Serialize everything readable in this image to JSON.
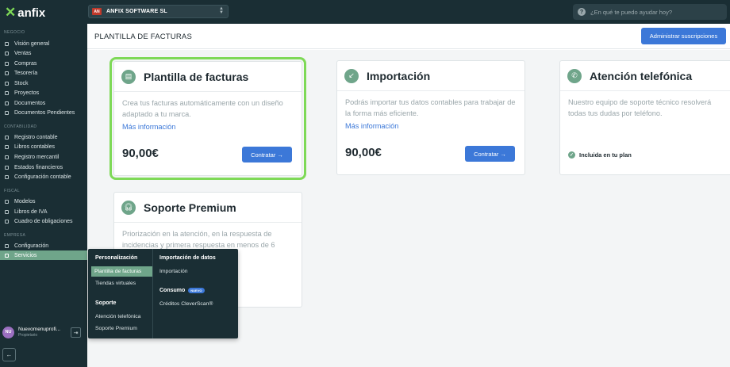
{
  "topbar": {
    "logo_text": "anfix",
    "company_badge": "AN",
    "company_name": "ANFIX SOFTWARE SL",
    "help_placeholder": "¿En qué te puedo ayudar hoy?"
  },
  "sidebar": {
    "sections": [
      {
        "label": "NEGOCIO",
        "items": [
          "Visión general",
          "Ventas",
          "Compras",
          "Tesorería",
          "Stock",
          "Proyectos",
          "Documentos",
          "Documentos Pendientes"
        ]
      },
      {
        "label": "CONTABILIDAD",
        "items": [
          "Registro contable",
          "Libros contables",
          "Registro mercantil",
          "Estados financieros",
          "Configuración contable"
        ]
      },
      {
        "label": "FISCAL",
        "items": [
          "Modelos",
          "Libros de IVA",
          "Cuadro de obligaciones"
        ]
      },
      {
        "label": "EMPRESA",
        "items": [
          "Configuración",
          "Servicios"
        ]
      }
    ],
    "active_item": "Servicios",
    "user": {
      "initials": "NU",
      "name": "Nuevomenuprofi...",
      "role": "Propietario"
    }
  },
  "header": {
    "title": "PLANTILLA DE FACTURAS",
    "admin_button": "Administrar suscripciones"
  },
  "cards": {
    "plantilla": {
      "title": "Plantilla de facturas",
      "desc": "Crea tus facturas automáticamente con un diseño adaptado a tu marca.",
      "link": "Más información",
      "price": "90,00€",
      "button": "Contratar →"
    },
    "importacion": {
      "title": "Importación",
      "desc": "Podrás importar tus datos contables para trabajar de la forma más eficiente.",
      "link": "Más información",
      "price": "90,00€",
      "button": "Contratar →"
    },
    "atencion": {
      "title": "Atención telefónica",
      "desc": "Nuestro equipo de soporte técnico resolverá todas tus dudas por teléfono.",
      "included": "Incluida en tu plan"
    },
    "soporte": {
      "title": "Soporte Premium",
      "desc": "Priorización en la atención, en la respuesta de incidencias y primera respuesta en menos de 6"
    }
  },
  "flyout": {
    "personalizacion": "Personalización",
    "plantilla": "Plantilla de facturas",
    "tiendas": "Tiendas virtuales",
    "soporte": "Soporte",
    "atencion": "Atención telefónica",
    "soporte_premium": "Soporte Premium",
    "importacion_head": "Importación de datos",
    "importacion": "Importación",
    "consumo": "Consumo",
    "nuevo": "NUEVO",
    "creditos": "Créditos CleverScan®"
  },
  "colors": {
    "sidebar_bg": "#1a2e34",
    "accent": "#3c78d8",
    "active_green": "#6fa58a",
    "highlight": "#7ed957"
  }
}
